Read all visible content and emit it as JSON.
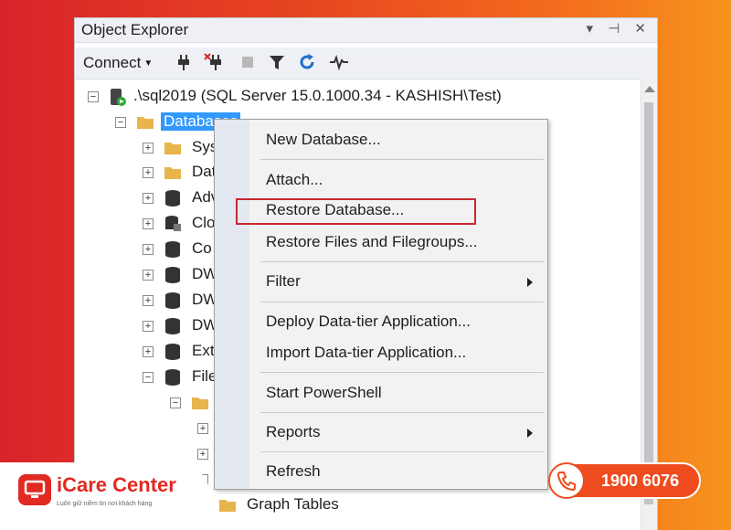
{
  "window": {
    "title": "Object Explorer",
    "controls": "▾ ⊣ ✕",
    "toolbar": {
      "connect_label": "Connect",
      "icons": [
        "connect-plug-icon",
        "disconnect-icon",
        "stop-icon",
        "filter-icon",
        "refresh-icon",
        "activity-monitor-icon"
      ]
    }
  },
  "tree": {
    "server": ".\\sql2019 (SQL Server 15.0.1000.34 - KASHISH\\Test)",
    "databases": "Databases",
    "children": [
      {
        "label": "Sys",
        "icon": "folder-icon"
      },
      {
        "label": "Dat",
        "icon": "folder-icon"
      },
      {
        "label": "Adv",
        "icon": "database-icon"
      },
      {
        "label": "Clo",
        "icon": "database-locked-icon",
        "suffix": ")"
      },
      {
        "label": "Co",
        "icon": "database-icon"
      },
      {
        "label": "DW",
        "icon": "database-icon"
      },
      {
        "label": "DW",
        "icon": "database-icon"
      },
      {
        "label": "DW",
        "icon": "database-icon"
      },
      {
        "label": "Ext",
        "icon": "database-icon"
      },
      {
        "label": "File",
        "icon": "database-icon"
      }
    ],
    "graph_tables": "Graph Tables"
  },
  "context_menu": {
    "items": [
      {
        "label": "New Database..."
      },
      {
        "label": "Attach..."
      },
      {
        "label": "Restore Database..."
      },
      {
        "label": "Restore Files and Filegroups..."
      },
      {
        "label": "Filter"
      },
      {
        "label": "Deploy Data-tier Application..."
      },
      {
        "label": "Import Data-tier Application..."
      },
      {
        "label": "Start PowerShell"
      },
      {
        "label": "Reports"
      },
      {
        "label": "Refresh"
      }
    ],
    "highlighted": "Restore Database..."
  },
  "branding": {
    "name": "iCare Center",
    "tagline": "Luôn giữ niềm tin nơi khách hàng",
    "hotline": "1900 6076"
  },
  "colors": {
    "selection": "#3399ff",
    "highlight_border": "#c8282e",
    "brand_red": "#e02a22",
    "hotline_orange": "#ee4c1f"
  }
}
